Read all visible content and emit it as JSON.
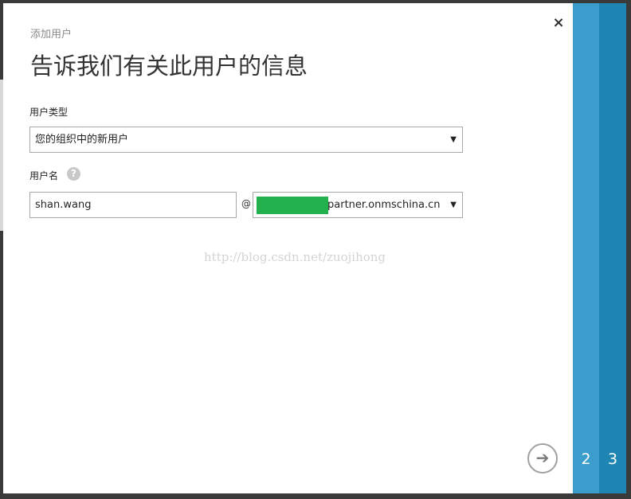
{
  "dialog": {
    "subtitle": "添加用户",
    "title": "告诉我们有关此用户的信息",
    "close_label": "×"
  },
  "form": {
    "user_type": {
      "label": "用户类型",
      "value": "您的组织中的新用户"
    },
    "username": {
      "label": "用户名",
      "help_label": "?",
      "value": "shan.wang",
      "at_symbol": "@",
      "domain_suffix": "partner.onmschina.cn"
    }
  },
  "watermark": "http://blog.csdn.net/zuojihong",
  "wizard": {
    "next_label": "➔",
    "steps": [
      {
        "label": "2"
      },
      {
        "label": "3"
      }
    ]
  },
  "icons": {
    "close": "close-icon",
    "help": "help-icon",
    "dropdown": "chevron-down-icon",
    "next": "arrow-right-icon"
  },
  "colors": {
    "step2": "#3a9dcb",
    "step3": "#1f86b3",
    "redaction": "#22b14c"
  }
}
